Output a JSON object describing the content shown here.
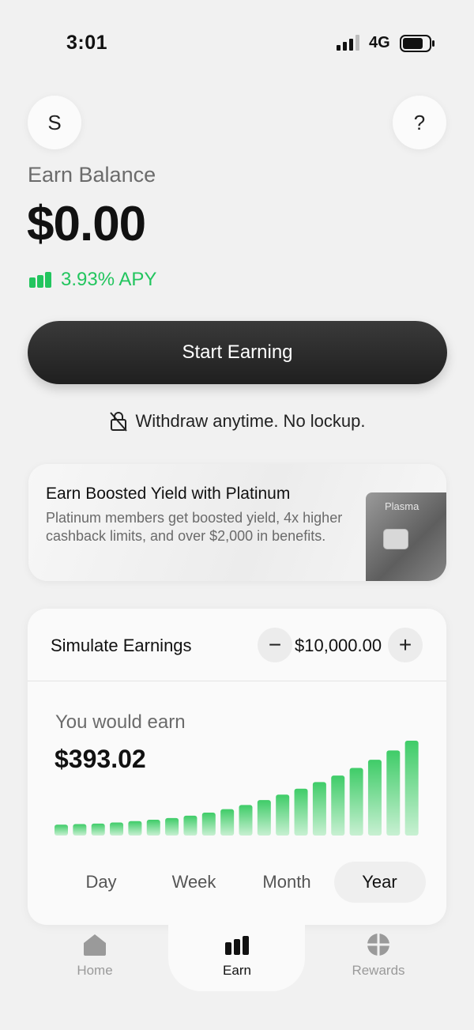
{
  "status_bar": {
    "time": "3:01",
    "network": "4G"
  },
  "header": {
    "avatar_initial": "S",
    "help_label": "?"
  },
  "balance": {
    "label": "Earn Balance",
    "value": "$0.00",
    "apy": "3.93% APY"
  },
  "cta": {
    "start_label": "Start Earning",
    "withdraw_note": "Withdraw anytime. No lockup."
  },
  "promo": {
    "title": "Earn Boosted Yield with Platinum",
    "body": "Platinum members get boosted yield, 4x higher cashback limits, and over $2,000 in benefits.",
    "card_brand": "Plasma"
  },
  "simulator": {
    "title": "Simulate Earnings",
    "amount": "$10,000.00",
    "earn_label": "You would earn",
    "earn_value": "$393.02",
    "periods": [
      "Day",
      "Week",
      "Month",
      "Year"
    ],
    "active_period": "Year"
  },
  "chart_data": {
    "type": "bar",
    "values": [
      1.0,
      1.05,
      1.1,
      1.2,
      1.32,
      1.45,
      1.6,
      1.82,
      2.1,
      2.42,
      2.8,
      3.25,
      3.75,
      4.3,
      4.9,
      5.5,
      6.2,
      6.95,
      7.8,
      8.7
    ],
    "color_start": "#c8f0d2",
    "color_end": "#3fcc68"
  },
  "tabbar": {
    "items": [
      {
        "label": "Home",
        "icon": "home-icon"
      },
      {
        "label": "Earn",
        "icon": "earn-bars-icon"
      },
      {
        "label": "Rewards",
        "icon": "rewards-icon"
      }
    ],
    "active": "Earn"
  },
  "colors": {
    "accent_green": "#22c55e",
    "button_dark": "#2a2a2a",
    "background": "#f1f1f1"
  }
}
